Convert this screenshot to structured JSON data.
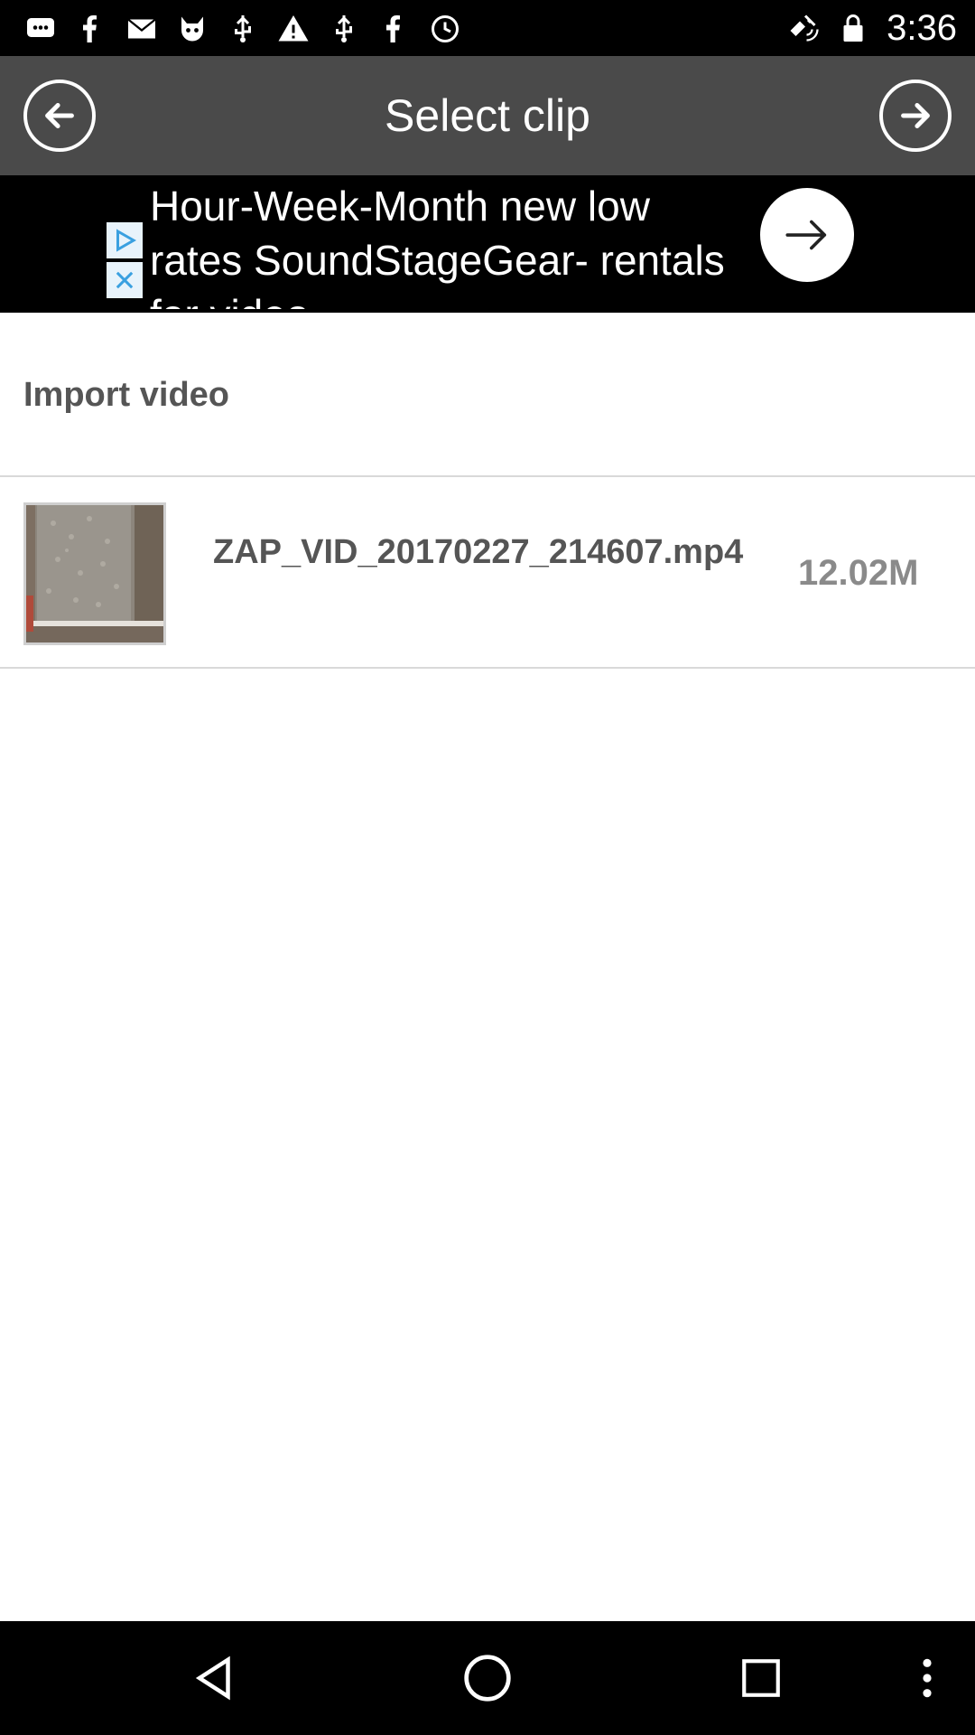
{
  "status_bar": {
    "time": "3:36",
    "left_icons": [
      "messages-icon",
      "facebook-icon",
      "email-icon",
      "cat-app-icon",
      "usb-icon",
      "warning-icon",
      "usb-icon",
      "facebook-icon",
      "sync-icon"
    ],
    "right_icons": [
      "fake-gps-icon",
      "lock-icon"
    ]
  },
  "toolbar": {
    "title": "Select clip",
    "back_icon": "arrow-left-circle-icon",
    "forward_icon": "arrow-right-circle-icon"
  },
  "ad": {
    "text": "Hour-Week-Month new low rates SoundStageGear- rentals for video"
  },
  "section": {
    "title": "Import video"
  },
  "videos": [
    {
      "name": "ZAP_VID_20170227_214607.mp4",
      "size": "12.02M"
    }
  ],
  "colors": {
    "toolbar_bg": "#4a4a4a",
    "status_bg": "#000000",
    "text_dark": "#555555",
    "size_text": "#8a8a8a"
  }
}
